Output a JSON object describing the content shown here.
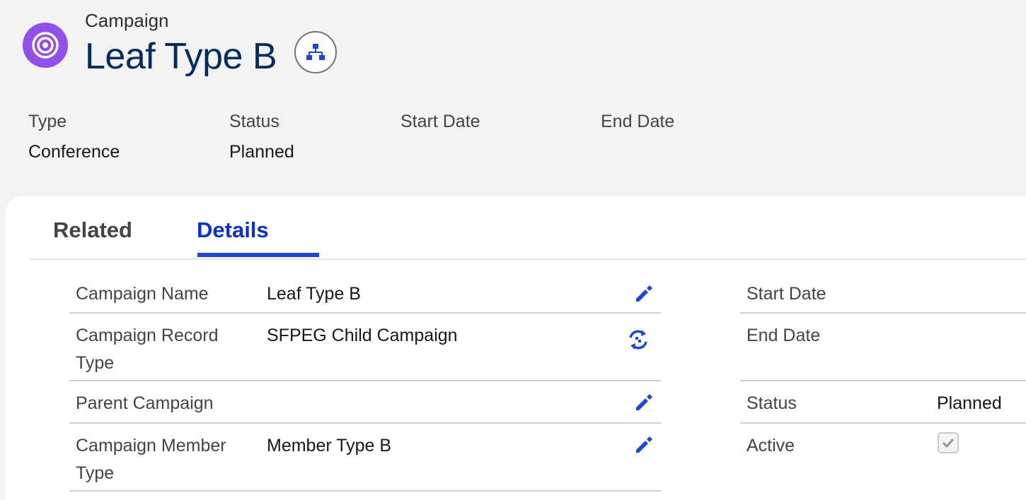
{
  "header": {
    "object_label": "Campaign",
    "title": "Leaf Type B",
    "icon": "campaign-target-icon",
    "hierarchy_button_icon": "hierarchy-icon",
    "icon_color": "#9050e9",
    "highlights": [
      {
        "label": "Type",
        "value": "Conference"
      },
      {
        "label": "Status",
        "value": "Planned"
      },
      {
        "label": "Start Date",
        "value": ""
      },
      {
        "label": "End Date",
        "value": ""
      }
    ]
  },
  "tabs": [
    {
      "label": "Related",
      "active": false
    },
    {
      "label": "Details",
      "active": true
    }
  ],
  "details": {
    "left": [
      {
        "label": "Campaign Name",
        "value": "Leaf Type B",
        "action_icon": "pencil-edit-icon"
      },
      {
        "label": "Campaign Record Type",
        "value": "SFPEG Child Campaign",
        "action_icon": "change-record-type-icon"
      },
      {
        "label": "Parent Campaign",
        "value": "",
        "action_icon": "pencil-edit-icon"
      },
      {
        "label": "Campaign Member Type",
        "value": "Member Type B",
        "action_icon": "pencil-edit-icon"
      }
    ],
    "right": [
      {
        "label": "Start Date",
        "value": ""
      },
      {
        "label": "End Date",
        "value": ""
      },
      {
        "label": "Status",
        "value": "Planned"
      },
      {
        "label": "Active",
        "value": "checked"
      }
    ]
  },
  "colors": {
    "accent": "#0b2fd1",
    "edit_icon": "#1b48d6",
    "title": "#032d60"
  }
}
